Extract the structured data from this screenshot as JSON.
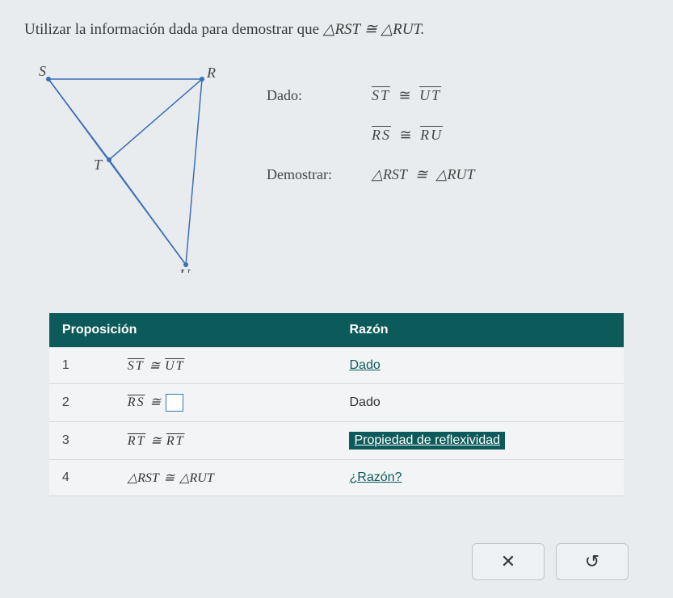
{
  "problem": {
    "prefix": "Utilizar la información dada para demostrar que ",
    "tri1": "△RST",
    "cong": "≅",
    "tri2": "△RUT."
  },
  "figure": {
    "labels": {
      "S": "S",
      "R": "R",
      "T": "T",
      "U": "U"
    }
  },
  "givens": {
    "dado_label": "Dado:",
    "line1": {
      "a": "ST",
      "op": "≅",
      "b": "UT"
    },
    "line2": {
      "a": "RS",
      "op": "≅",
      "b": "RU"
    },
    "demo_label": "Demostrar:",
    "demo": {
      "a": "△RST",
      "op": "≅",
      "b": "△RUT"
    }
  },
  "table": {
    "headers": {
      "prop": "Proposición",
      "reason": "Razón"
    },
    "rows": [
      {
        "n": "1",
        "prop_a": "ST",
        "prop_op": "≅",
        "prop_b": "UT",
        "reason": "Dado",
        "reason_type": "link"
      },
      {
        "n": "2",
        "prop_a": "RS",
        "prop_op": "≅",
        "prop_b": "",
        "reason": "Dado",
        "reason_type": "plain",
        "has_input": true
      },
      {
        "n": "3",
        "prop_a": "RT",
        "prop_op": "≅",
        "prop_b": "RT",
        "reason": "Propiedad de reflexividad",
        "reason_type": "highlight"
      },
      {
        "n": "4",
        "prop_a": "△RST",
        "prop_op": "≅",
        "prop_b": "△RUT",
        "reason": "¿Razón?",
        "reason_type": "link",
        "no_overline": true
      }
    ]
  },
  "buttons": {
    "close": "✕",
    "reset": "↺"
  }
}
